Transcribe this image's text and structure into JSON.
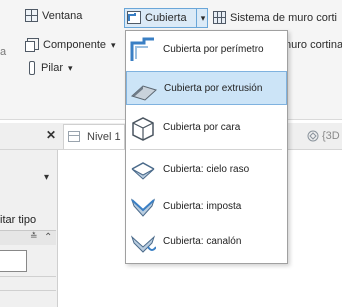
{
  "ribbon": {
    "ventana_label": "Ventana",
    "componente_label": "Componente",
    "componente_arrow": "▾",
    "pilar_label": "Pilar",
    "pilar_arrow": "▾",
    "cubierta_label": "Cubierta",
    "cubierta_arrow": "▾",
    "sistema_label": "Sistema de muro corti",
    "muro_cortina_label": "nuro cortina",
    "left_cut_text": "a"
  },
  "view_tabs": {
    "close_glyph": "✕",
    "nivel_label": "Nivel 1",
    "view3d_label": "{3D"
  },
  "left_panel": {
    "dropdown_arrow": "▾",
    "editar_tipo_label": "itar tipo",
    "scroll_label": "≛",
    "scroll_up": "⌃"
  },
  "menu": {
    "items": [
      {
        "label": "Cubierta por perímetro",
        "icon": "roof-footprint-icon",
        "active": false
      },
      {
        "label": "Cubierta por extrusión",
        "icon": "roof-extrusion-icon",
        "active": true
      },
      {
        "label": "Cubierta por cara",
        "icon": "roof-by-face-icon",
        "active": false
      },
      {
        "label": "Cubierta: cielo raso",
        "icon": "roof-soffit-icon",
        "active": false
      },
      {
        "label": "Cubierta: imposta",
        "icon": "roof-fascia-icon",
        "active": false
      },
      {
        "label": "Cubierta: canalón",
        "icon": "roof-gutter-icon",
        "active": false
      }
    ]
  },
  "colors": {
    "highlight": "#cce4f7",
    "highlight_border": "#7fb2df",
    "accent_blue": "#3a7fc4"
  }
}
